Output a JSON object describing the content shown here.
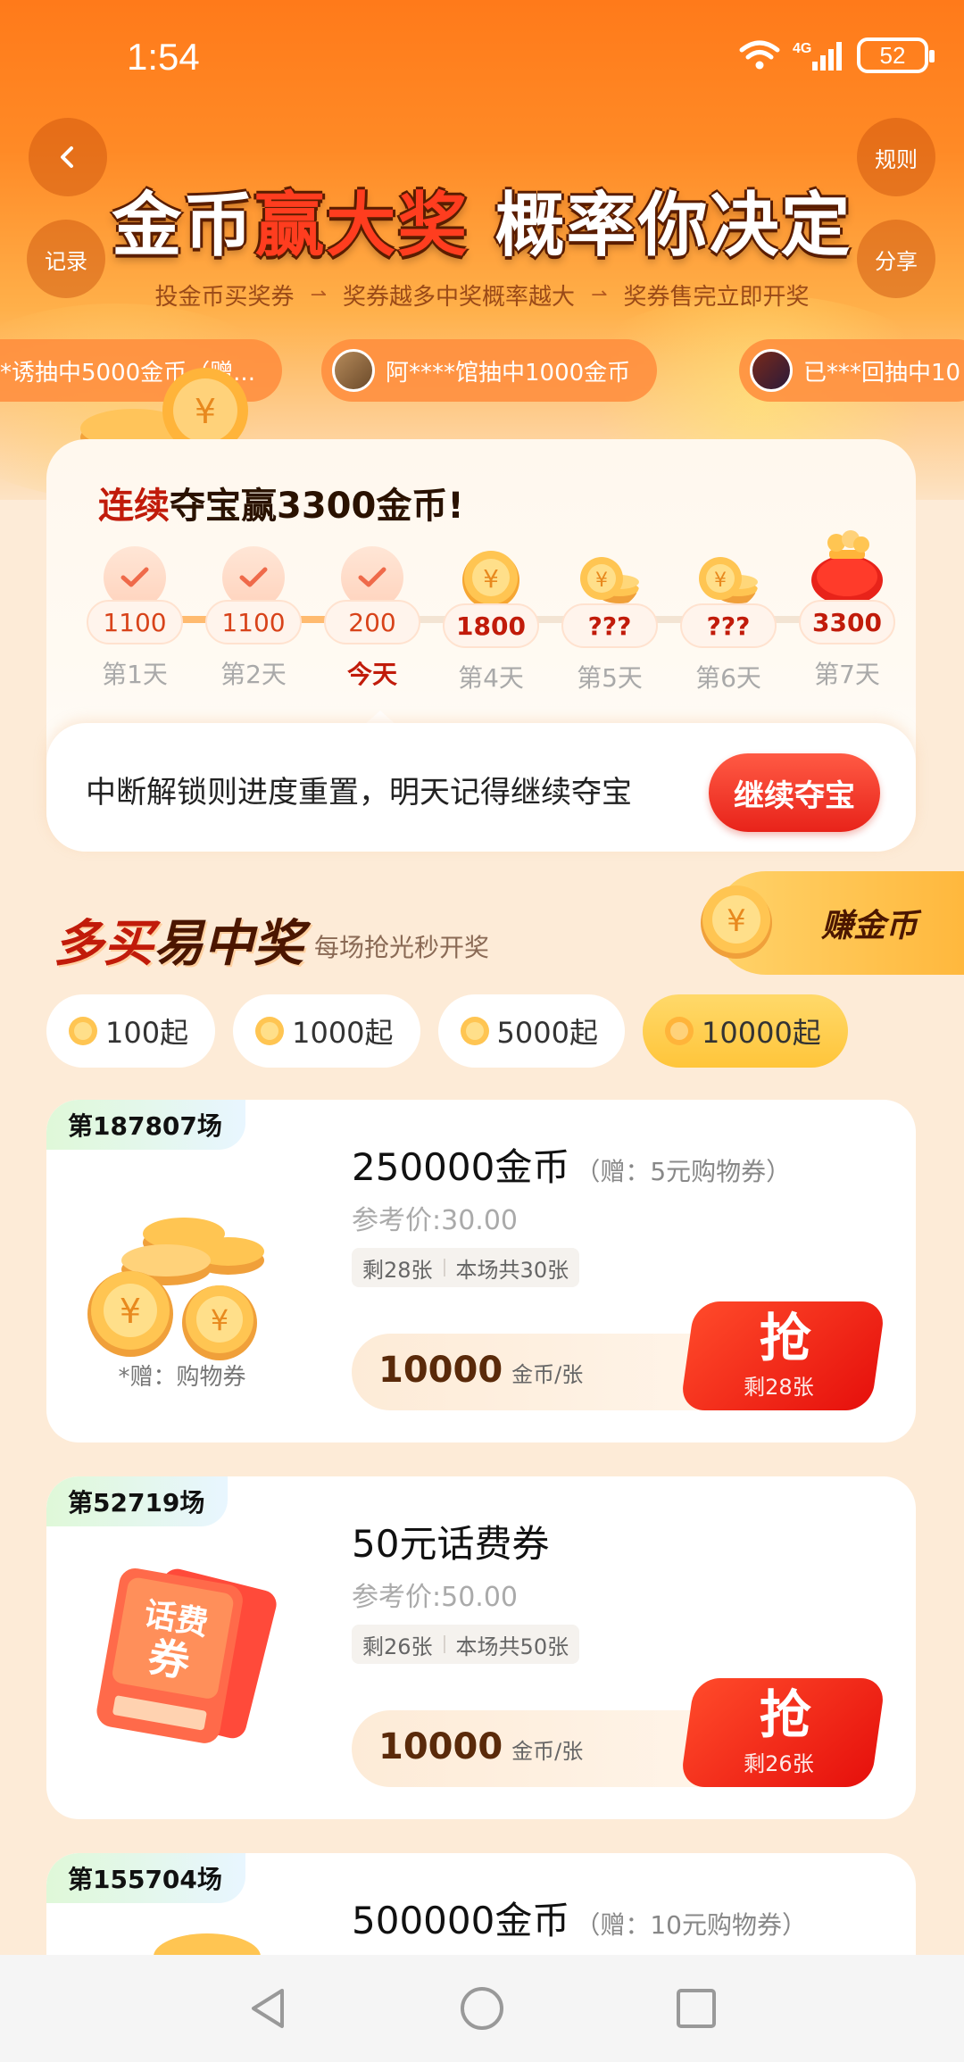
{
  "status": {
    "time": "1:54",
    "network": "4G",
    "battery": "52"
  },
  "header": {
    "title_a": "金币",
    "title_b": "赢大奖",
    "title_c": "概率你决定",
    "steps": [
      "投金币买奖券",
      "奖券越多中奖概率越大",
      "奖券售完立即开奖"
    ],
    "back_icon": "chevron-left-icon",
    "record_label": "记录",
    "rules_label": "规则",
    "share_label": "分享"
  },
  "ticker": [
    {
      "text": "*诱抽中5000金币（赠..."
    },
    {
      "text": "阿****馆抽中1000金币"
    },
    {
      "text": "已***回抽中10"
    }
  ],
  "streak": {
    "title_hl": "连续",
    "title_rest": "夺宝赢3300金币!",
    "days": [
      {
        "amount": "1100",
        "label": "第1天",
        "state": "done"
      },
      {
        "amount": "1100",
        "label": "第2天",
        "state": "done"
      },
      {
        "amount": "200",
        "label": "今天",
        "state": "today"
      },
      {
        "amount": "1800",
        "label": "第4天",
        "state": "coin"
      },
      {
        "amount": "???",
        "label": "第5天",
        "state": "coins"
      },
      {
        "amount": "???",
        "label": "第6天",
        "state": "coins"
      },
      {
        "amount": "3300",
        "label": "第7天",
        "state": "bag"
      }
    ],
    "tip": "中断解锁则进度重置，明天记得继续夺宝",
    "continue_label": "继续夺宝"
  },
  "section": {
    "title_a": "多买",
    "title_b": "易中奖",
    "subtitle": "每场抢光秒开奖",
    "earn_label": "赚金币"
  },
  "filters": [
    {
      "label": "100起",
      "active": false
    },
    {
      "label": "1000起",
      "active": false
    },
    {
      "label": "5000起",
      "active": false
    },
    {
      "label": "10000起",
      "active": true
    }
  ],
  "products": [
    {
      "round": "第187807场",
      "name": "250000金币",
      "gift": "（赠：5元购物券）",
      "ref_price": "参考价:30.00",
      "remaining": "剩28张",
      "total": "本场共30张",
      "price": "10000",
      "unit": "金币/张",
      "grab": "抢",
      "grab_sub": "剩28张",
      "gift_note": "*赠：购物券",
      "image": "coins"
    },
    {
      "round": "第52719场",
      "name": "50元话费券",
      "gift": "",
      "ref_price": "参考价:50.00",
      "remaining": "剩26张",
      "total": "本场共50张",
      "price": "10000",
      "unit": "金币/张",
      "grab": "抢",
      "grab_sub": "剩26张",
      "gift_note": "",
      "image": "voucher",
      "voucher_text_1": "话费",
      "voucher_text_2": "券"
    },
    {
      "round": "第155704场",
      "name": "500000金币",
      "gift": "（赠：10元购物券）"
    }
  ],
  "colors": {
    "accent": "#ff7a1a",
    "red": "#e8231a",
    "gold": "#ffc53a"
  }
}
